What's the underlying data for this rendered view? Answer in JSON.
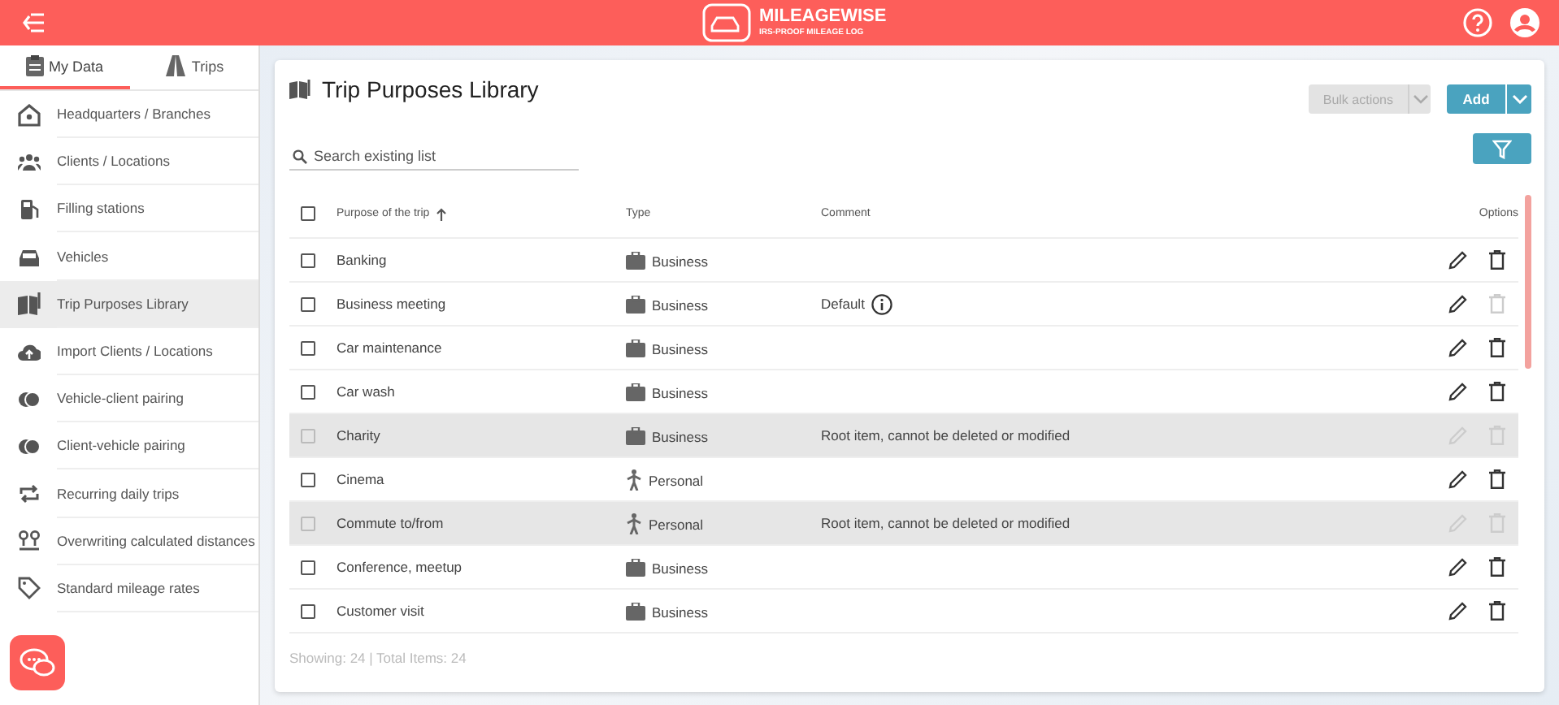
{
  "header": {
    "brand": "MILEAGEWISE",
    "tagline": "IRS-PROOF MILEAGE LOG"
  },
  "sidebar": {
    "tabs": [
      {
        "label": "My Data",
        "selected": true,
        "kind": "data"
      },
      {
        "label": "Trips",
        "selected": false,
        "kind": "road"
      }
    ],
    "items": [
      {
        "label": "Headquarters / Branches",
        "kind": "home",
        "selected": false
      },
      {
        "label": "Clients / Locations",
        "kind": "people",
        "selected": false
      },
      {
        "label": "Filling stations",
        "kind": "fuel",
        "selected": false
      },
      {
        "label": "Vehicles",
        "kind": "car",
        "selected": false
      },
      {
        "label": "Trip Purposes Library",
        "kind": "book",
        "selected": true
      },
      {
        "label": "Import Clients / Locations",
        "kind": "upload",
        "selected": false
      },
      {
        "label": "Vehicle-client pairing",
        "kind": "pair",
        "selected": false
      },
      {
        "label": "Client-vehicle pairing",
        "kind": "pair",
        "selected": false
      },
      {
        "label": "Recurring daily trips",
        "kind": "repeat",
        "selected": false
      },
      {
        "label": "Overwriting calculated distances",
        "kind": "pins",
        "selected": false
      },
      {
        "label": "Standard mileage rates",
        "kind": "tag",
        "selected": false
      }
    ]
  },
  "page": {
    "title": "Trip Purposes Library",
    "bulk_button": "Bulk actions",
    "add_button": "Add",
    "search": {
      "placeholder": "Search existing list"
    }
  },
  "table": {
    "header_checked": false,
    "columns": [
      "Purpose of the trip",
      "Type",
      "Comment",
      "Options"
    ],
    "rows": [
      {
        "purpose": "Banking",
        "kind": "business",
        "type": "Business",
        "comment": "",
        "info": false,
        "root": false,
        "delete_disabled": false,
        "checked": false
      },
      {
        "purpose": "Business meeting",
        "kind": "business",
        "type": "Business",
        "comment": "Default",
        "info": true,
        "root": false,
        "delete_disabled": true,
        "checked": false
      },
      {
        "purpose": "Car maintenance",
        "kind": "business",
        "type": "Business",
        "comment": "",
        "info": false,
        "root": false,
        "delete_disabled": false,
        "checked": false
      },
      {
        "purpose": "Car wash",
        "kind": "business",
        "type": "Business",
        "comment": "",
        "info": false,
        "root": false,
        "delete_disabled": false,
        "checked": false
      },
      {
        "purpose": "Charity",
        "kind": "business",
        "type": "Business",
        "comment": "Root item, cannot be deleted or modified",
        "info": false,
        "root": true,
        "delete_disabled": true,
        "checked": false
      },
      {
        "purpose": "Cinema",
        "kind": "personal",
        "type": "Personal",
        "comment": "",
        "info": false,
        "root": false,
        "delete_disabled": false,
        "checked": false
      },
      {
        "purpose": "Commute to/from",
        "kind": "personal",
        "type": "Personal",
        "comment": "Root item, cannot be deleted or modified",
        "info": false,
        "root": true,
        "delete_disabled": true,
        "checked": false
      },
      {
        "purpose": "Conference, meetup",
        "kind": "business",
        "type": "Business",
        "comment": "",
        "info": false,
        "root": false,
        "delete_disabled": false,
        "checked": false
      },
      {
        "purpose": "Customer visit",
        "kind": "business",
        "type": "Business",
        "comment": "",
        "info": false,
        "root": false,
        "delete_disabled": false,
        "checked": false
      }
    ],
    "footer": "Showing: 24 | Total Items: 24"
  }
}
